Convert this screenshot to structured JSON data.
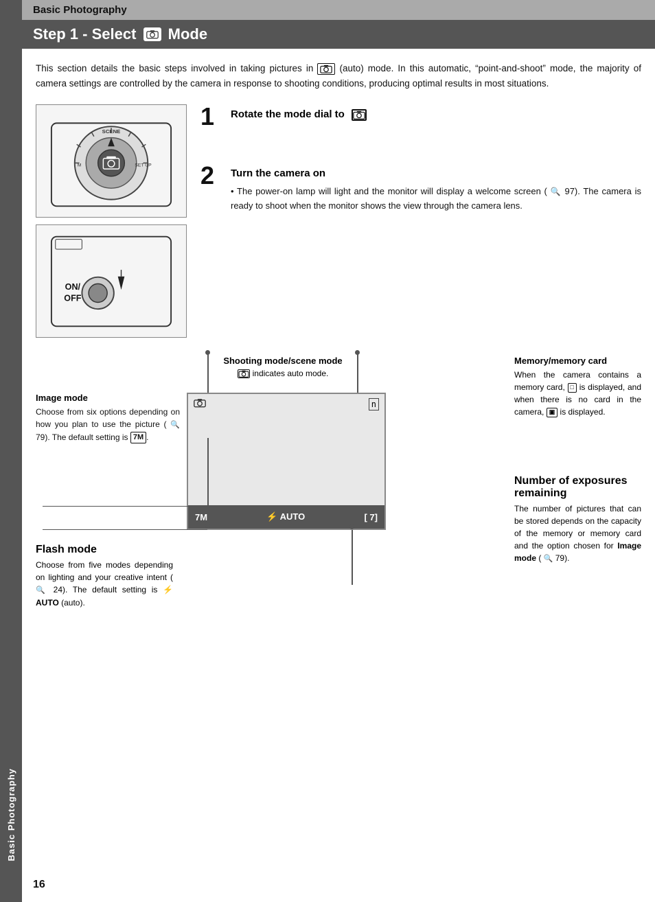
{
  "page": {
    "number": "16"
  },
  "sideTab": {
    "label": "Basic Photography"
  },
  "header": {
    "section": "Basic Photography",
    "stepTitle": "Step 1 - Select",
    "stepTitleEnd": "Mode"
  },
  "intro": {
    "text": "This section details the basic steps involved in taking pictures in  (auto) mode. In this automatic, “point-and-shoot” mode, the majority of camera settings are controlled by the camera in response to shooting conditions, producing optimal results in most situations."
  },
  "steps": [
    {
      "number": "1",
      "title": "Rotate the mode dial to",
      "content": ""
    },
    {
      "number": "2",
      "title": "Turn the camera on",
      "bullet": "The power-on lamp will light and the monitor will display a welcome screen (  97). The camera is ready to shoot when the monitor shows the view through the camera lens."
    }
  ],
  "diagramAnnotations": {
    "shootingMode": {
      "title": "Shooting mode/scene mode",
      "text": "indicates auto mode."
    },
    "memoryCard": {
      "title": "Memory/memory card",
      "text": "When the camera contains a memory card,  is displayed, and when there is no card in the camera,  is displayed."
    },
    "imageMode": {
      "title": "Image mode",
      "text": "Choose from six options depending on how you plan to use the picture ( 79). The default setting is 7M."
    },
    "flashMode": {
      "title": "Flash mode",
      "text": "Choose from five modes depending on lighting and your creative intent ( 24). The default setting is  AUTO (auto)."
    },
    "exposures": {
      "title": "Number of exposures remaining",
      "text": "The number of pictures that can be stored depends on the capacity of the memory or memory card and the option chosen for Image mode ( 79)."
    }
  },
  "screen": {
    "topLeft": "■",
    "topRight": "n",
    "bottomLeft": "7M",
    "bottomMiddle": "⚡ AUTO",
    "bottomRight": "[ 7]"
  }
}
